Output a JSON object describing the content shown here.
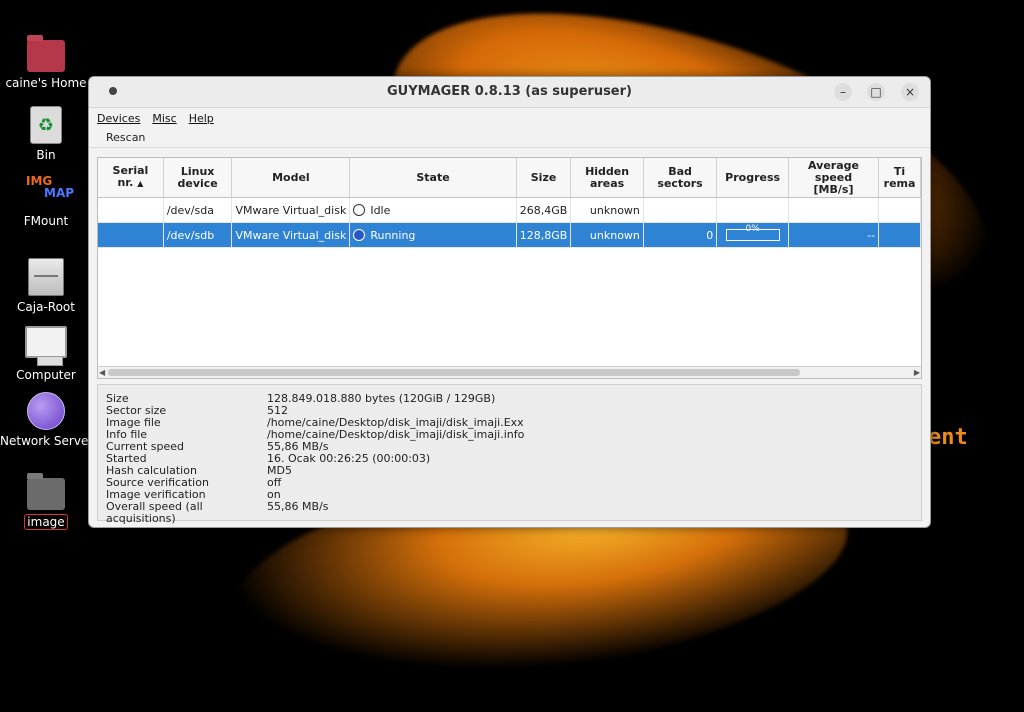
{
  "desktop": {
    "icons": [
      {
        "label": "caine's Home"
      },
      {
        "label": "Bin"
      },
      {
        "label": "FMount",
        "badge_a": "IMG",
        "badge_b": "MAP"
      },
      {
        "label": "Caja-Root"
      },
      {
        "label": "Computer"
      },
      {
        "label": "Network Server"
      },
      {
        "label": "image"
      }
    ],
    "wallpaper_text": "ent"
  },
  "window": {
    "title": "GUYMAGER 0.8.13 (as superuser)",
    "controls": {
      "minimize": "–",
      "maximize": "□",
      "close": "×"
    }
  },
  "menu": [
    "Devices",
    "Misc",
    "Help"
  ],
  "toolbar": {
    "rescan": "Rescan"
  },
  "table": {
    "columns": [
      "Serial\nnr.",
      "Linux\ndevice",
      "Model",
      "State",
      "Size",
      "Hidden\nareas",
      "Bad\nsectors",
      "Progress",
      "Average\nspeed\n[MB/s]",
      "Ti\nrema"
    ],
    "rows": [
      {
        "serial": "",
        "device": "/dev/sda",
        "model": "VMware Virtual_disk",
        "state": "Idle",
        "size": "268,4GB",
        "hidden": "unknown",
        "bad": "",
        "progress": "",
        "speed": "",
        "time": ""
      },
      {
        "serial": "",
        "device": "/dev/sdb",
        "model": "VMware Virtual_disk",
        "state": "Running",
        "size": "128,8GB",
        "hidden": "unknown",
        "bad": "0",
        "progress": "0%",
        "speed": "--",
        "time": ""
      }
    ]
  },
  "info": [
    {
      "key": "Size",
      "value": "128.849.018.880 bytes (120GiB / 129GB)"
    },
    {
      "key": "Sector size",
      "value": "512"
    },
    {
      "key": "Image file",
      "value": "/home/caine/Desktop/disk_imaji/disk_imaji.Exx"
    },
    {
      "key": "Info file",
      "value": "/home/caine/Desktop/disk_imaji/disk_imaji.info"
    },
    {
      "key": "Current speed",
      "value": "55,86 MB/s"
    },
    {
      "key": "Started",
      "value": "16. Ocak 00:26:25 (00:00:03)"
    },
    {
      "key": "Hash calculation",
      "value": "MD5"
    },
    {
      "key": "Source verification",
      "value": "off"
    },
    {
      "key": "Image verification",
      "value": "on"
    },
    {
      "key": "Overall speed (all acquisitions)",
      "value": "55,86 MB/s"
    }
  ]
}
